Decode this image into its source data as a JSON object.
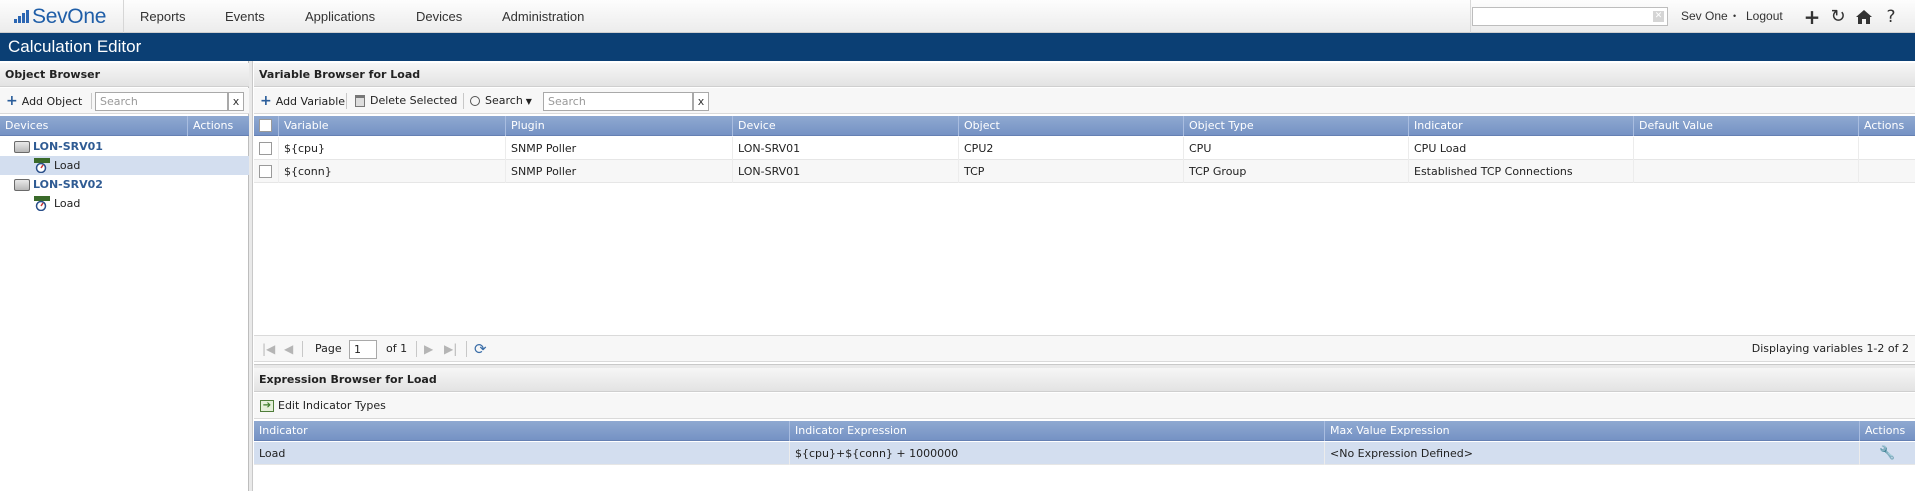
{
  "topnav": {
    "logo": "SevOne",
    "menu": [
      "Reports",
      "Events",
      "Applications",
      "Devices",
      "Administration"
    ],
    "search_value": "",
    "user": "Sev One",
    "separator": "•",
    "logout": "Logout"
  },
  "page_title": "Calculation Editor",
  "object_browser": {
    "title": "Object Browser",
    "add_label": "Add Object",
    "search_placeholder": "Search",
    "clear": "x",
    "columns": [
      "Devices",
      "Actions"
    ],
    "tree": [
      {
        "device": "LON-SRV01",
        "objects": [
          "Load"
        ]
      },
      {
        "device": "LON-SRV02",
        "objects": [
          "Load"
        ]
      }
    ]
  },
  "variable_browser": {
    "title": "Variable Browser for Load",
    "add_label": "Add Variable",
    "delete_label": "Delete Selected",
    "search_label": "Search",
    "search_placeholder": "Search",
    "clear": "x",
    "columns": [
      "Variable",
      "Plugin",
      "Device",
      "Object",
      "Object Type",
      "Indicator",
      "Default Value",
      "Actions"
    ],
    "rows": [
      [
        "${cpu}",
        "SNMP Poller",
        "LON-SRV01",
        "CPU2",
        "CPU",
        "CPU Load",
        ""
      ],
      [
        "${conn}",
        "SNMP Poller",
        "LON-SRV01",
        "TCP",
        "TCP Group",
        "Established TCP Connections",
        ""
      ]
    ],
    "pager": {
      "page_label": "Page",
      "page_value": "1",
      "of_label": "of 1",
      "display": "Displaying variables 1-2 of 2"
    }
  },
  "expression_browser": {
    "title": "Expression Browser for Load",
    "edit_label": "Edit Indicator Types",
    "columns": [
      "Indicator",
      "Indicator Expression",
      "Max Value Expression",
      "Actions"
    ],
    "rows": [
      [
        "Load",
        "${cpu}+${conn} + 1000000",
        "<No Expression Defined>"
      ]
    ]
  },
  "colors": {
    "nav_title": "#0b3f74",
    "grid_header": "#7f9ccb",
    "selected_row": "#d3deef",
    "link": "#2f5b93"
  }
}
